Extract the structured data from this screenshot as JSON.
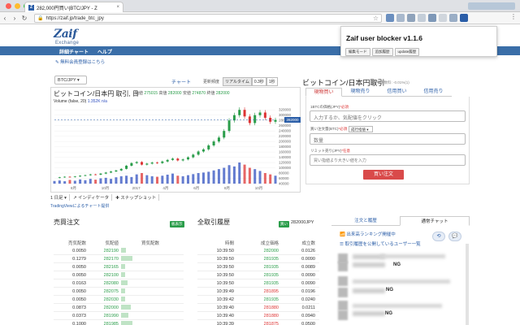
{
  "browser": {
    "tab_title": "282,000円買い|BTC/JPY - Z",
    "tab_close": "×",
    "url": "https://zaif.jp/trade_btc_jpy",
    "lock": "🔒",
    "back": "‹",
    "forward": "›",
    "reload": "↻",
    "star": "☆",
    "menu": "⋮"
  },
  "site": {
    "logo_text": "Zaif",
    "logo_sub": "Exchange",
    "nav": [
      "詳細チャート",
      "ヘルプ"
    ],
    "signup_link": "✎ 無料会員登録はこちら"
  },
  "popup": {
    "title": "Zaif user blocker v1.1.6",
    "buttons": [
      "編集モード",
      "追加履歴",
      "update履歴"
    ]
  },
  "chart_panel": {
    "pair": "BTC/JPY ▾",
    "chart_tab": "チャート",
    "period_label": "更新頻度",
    "period_buttons": [
      "リアルタイム",
      "0.3秒",
      "1秒"
    ],
    "title": "ビットコイン/日本円 取引, 日",
    "ohlc": {
      "o_label": "始値",
      "o": "275015",
      "h_label": "高値",
      "h": "282000",
      "l_label": "安値",
      "l": "274870",
      "c_label": "終値",
      "c": "282000"
    },
    "volume_label": "Volume (false, 20)",
    "volume_value": "1.352K n/a",
    "price_tag": "282000",
    "footer": [
      "1 日足 ▾",
      "↗ インディケータ",
      "✚ スナップショット"
    ],
    "credit": "TradingViewによるチャート提供"
  },
  "chart_data": {
    "type": "line",
    "title": "ビットコイン/日本円 取引, 日",
    "y_ticks": [
      "320000",
      "300000",
      "280000",
      "260000",
      "240000",
      "220000",
      "200000",
      "180000",
      "160000",
      "140000",
      "120000",
      "100000",
      "80000",
      "60000",
      "40000"
    ],
    "x_ticks": [
      "8月",
      "10月",
      "2017",
      "4月",
      "6月",
      "8月",
      "10月"
    ],
    "ylim": [
      40000,
      330000
    ],
    "price_series": [
      62000,
      64000,
      66000,
      65000,
      67000,
      70000,
      72000,
      75000,
      74000,
      78000,
      82000,
      86000,
      90000,
      96000,
      108000,
      118000,
      122000,
      112000,
      116000,
      120000,
      118000,
      124000,
      130000,
      135000,
      128000,
      132000,
      140000,
      150000,
      162000,
      170000,
      185000,
      200000,
      215000,
      240000,
      280000,
      300000,
      320000,
      295000,
      270000,
      300000,
      310000,
      290000,
      275000,
      282000
    ],
    "volume_series": [
      10,
      12,
      9,
      14,
      11,
      16,
      13,
      18,
      15,
      20,
      22,
      18,
      24,
      28,
      30,
      25,
      35,
      40,
      32,
      28,
      26,
      30,
      34,
      38,
      30,
      28,
      32,
      36,
      40,
      42,
      45,
      50,
      55,
      60,
      70,
      65,
      80,
      72,
      60,
      55,
      48,
      40,
      35,
      30
    ],
    "last_price": 282000
  },
  "order": {
    "title": "ビットコイン/日本円取引",
    "fee": "取引手数料: -0.01%(1)",
    "tabs": [
      "現物買い",
      "現物売り",
      "信用買い",
      "信用売り"
    ],
    "price_label": "1BTCの価格(JPY)",
    "price_req": "*必須",
    "price_placeholder": "入力するか、気配値をクリック",
    "amount_label": "買い注文量(BTC)",
    "amount_req": "*必須",
    "order_type": "成行指値 ▾",
    "amount_placeholder": "数量",
    "limit_label": "リミット売り(JPY)",
    "limit_opt": "*任意",
    "limit_placeholder": "買い指値より大きい値を入力",
    "buy_button": "買い注文"
  },
  "board": {
    "title": "売買注文",
    "badge": "板表示",
    "headers": [
      "売気配数",
      "気配値",
      "買気配数"
    ],
    "rows": [
      {
        "sell": "0.0050",
        "price": "282190",
        "buy": "",
        "bar": 6
      },
      {
        "sell": "0.1279",
        "price": "282170",
        "buy": "",
        "bar": 14
      },
      {
        "sell": "0.0050",
        "price": "282165",
        "buy": "",
        "bar": 5
      },
      {
        "sell": "0.0050",
        "price": "282100",
        "buy": "",
        "bar": 5
      },
      {
        "sell": "0.0163",
        "price": "282080",
        "buy": "",
        "bar": 8
      },
      {
        "sell": "0.0050",
        "price": "282075",
        "buy": "",
        "bar": 5
      },
      {
        "sell": "0.0050",
        "price": "282030",
        "buy": "",
        "bar": 5
      },
      {
        "sell": "0.0873",
        "price": "282000",
        "buy": "",
        "bar": 12
      },
      {
        "sell": "0.0373",
        "price": "281990",
        "buy": "",
        "bar": 9
      },
      {
        "sell": "0.1000",
        "price": "281985",
        "buy": "",
        "bar": 14
      }
    ]
  },
  "history": {
    "title": "全取引履歴",
    "badge_label": "買い",
    "badge_value": "282000JPY",
    "headers": [
      "時間",
      "成立価格",
      "成立数"
    ],
    "rows": [
      {
        "time": "10:39:50",
        "price": "282000",
        "qty": "0.0126",
        "side": "buy"
      },
      {
        "time": "10:39:50",
        "price": "281935",
        "qty": "0.0090",
        "side": "buy"
      },
      {
        "time": "10:39:50",
        "price": "281935",
        "qty": "0.0089",
        "side": "buy"
      },
      {
        "time": "10:39:50",
        "price": "281935",
        "qty": "0.0090",
        "side": "buy"
      },
      {
        "time": "10:39:50",
        "price": "281935",
        "qty": "0.0090",
        "side": "buy"
      },
      {
        "time": "10:39:49",
        "price": "281895",
        "qty": "0.0196",
        "side": "sell"
      },
      {
        "time": "10:39:42",
        "price": "281935",
        "qty": "0.0240",
        "side": "buy"
      },
      {
        "time": "10:39:40",
        "price": "281880",
        "qty": "0.0211",
        "side": "sell"
      },
      {
        "time": "10:39:40",
        "price": "281880",
        "qty": "0.0940",
        "side": "sell"
      },
      {
        "time": "10:39:39",
        "price": "281875",
        "qty": "0.0500",
        "side": "sell"
      }
    ]
  },
  "sidebar": {
    "tabs": [
      "注文と履歴",
      "通常チャット"
    ],
    "link1": "📶 出来高ランキング開催中",
    "link2": "☰ 取引履歴を公開しているユーザー一覧",
    "ng_labels": [
      "NG",
      "NG",
      "NG"
    ],
    "icon_refresh": "⟲",
    "icon_chat": "💬"
  },
  "colors": {
    "brand": "#3a6ea8",
    "buy": "#2a9d4a",
    "sell": "#d33",
    "candle_up": "#2a9d4a",
    "candle_down": "#d33",
    "volume_blue": "#3050c0"
  }
}
